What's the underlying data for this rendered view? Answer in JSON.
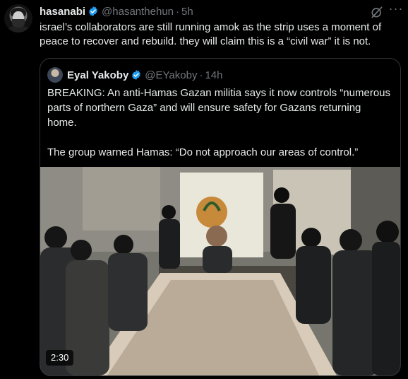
{
  "tweet": {
    "author_name": "hasanabi",
    "handle": "@hasanthehun",
    "separator": "·",
    "time": "5h",
    "text": "israel’s collaborators are still running amok as the strip uses a moment of peace to recover and rebuild. they will claim this is a “civil war” it is not.",
    "more_label": "···",
    "icons": {
      "verified": "verified-badge-icon",
      "grok": "grok-icon",
      "more": "more-icon"
    },
    "colors": {
      "background": "#000000",
      "text": "#e7e9ea",
      "muted": "#71767b",
      "verified": "#1d9bf0",
      "border": "#2f3336"
    }
  },
  "quote": {
    "author_name": "Eyal Yakoby",
    "handle": "@EYakoby",
    "separator": "·",
    "time": "14h",
    "paragraph1": "BREAKING: An anti-Hamas Gazan militia says it now controls “numerous parts of northern Gaza” and will ensure safety for Gazans returning home.",
    "paragraph2": "The group warned Hamas: “Do not approach our areas of control.”",
    "video": {
      "duration": "2:30"
    }
  }
}
